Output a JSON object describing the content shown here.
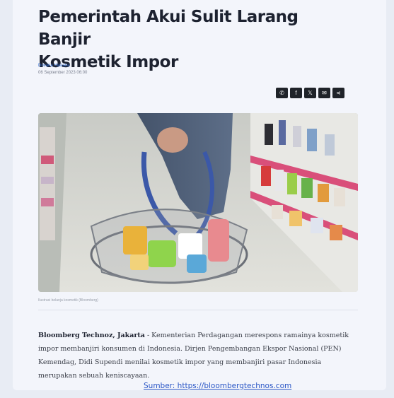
{
  "article": {
    "title_line1": "Pemerintah Akui Sulit Larang Banjir",
    "title_line2": "Kosmetik Impor",
    "author": "Dovana Hasiana",
    "date": "06 September 2023 06:00",
    "caption": "Ilustrasi belanja kosmetik (Bloomberg)",
    "lead_dateline": "Bloomberg Technoz, Jakarta",
    "lead_text": " - Kementerian Perdagangan merespons ramainya kosmetik impor membanjiri konsumen di Indonesia. Dirjen Pengembangan Ekspor Nasional (PEN) Kemendag, Didi Supendi menilai kosmetik impor yang membanjiri pasar Indonesia merupakan sebuah keniscayaan."
  },
  "share": {
    "whatsapp": "✆",
    "facebook": "f",
    "x": "𝕏",
    "email": "✉",
    "share": "⋖"
  },
  "source": {
    "label": "Sumber: https://bloombergtechnos.com"
  },
  "colors": {
    "accent": "#2f6bd1",
    "heading": "#1d2230",
    "share_bg": "#1f2329"
  }
}
